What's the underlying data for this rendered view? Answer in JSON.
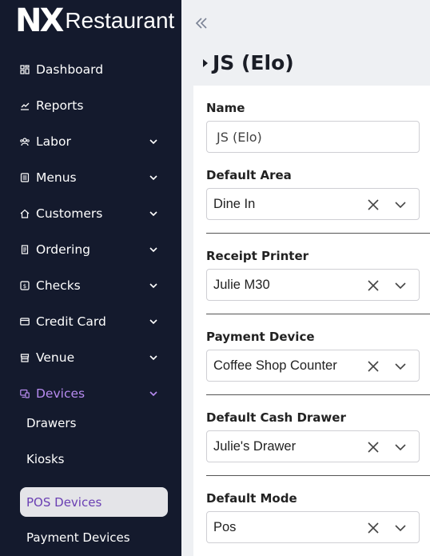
{
  "brand": {
    "mark": "NX",
    "name": "Restaurant"
  },
  "sidebar": {
    "items": [
      {
        "label": "Dashboard",
        "icon": "dashboard-icon",
        "expandable": false
      },
      {
        "label": "Reports",
        "icon": "chart-icon",
        "expandable": false
      },
      {
        "label": "Labor",
        "icon": "users-icon",
        "expandable": true
      },
      {
        "label": "Menus",
        "icon": "menu-icon",
        "expandable": true
      },
      {
        "label": "Customers",
        "icon": "home-icon",
        "expandable": true
      },
      {
        "label": "Ordering",
        "icon": "receipt-icon",
        "expandable": true
      },
      {
        "label": "Checks",
        "icon": "dollar-icon",
        "expandable": true
      },
      {
        "label": "Credit Card",
        "icon": "credit-card-icon",
        "expandable": true
      },
      {
        "label": "Venue",
        "icon": "store-icon",
        "expandable": true
      },
      {
        "label": "Devices",
        "icon": "devices-icon",
        "expandable": true,
        "active": true
      }
    ],
    "sub_items": [
      "Drawers",
      "Kiosks",
      "POS Devices",
      "Payment Devices"
    ],
    "active_sub": "POS Devices",
    "accent": "#b78bf0"
  },
  "main": {
    "title": "JS (Elo)",
    "fields": {
      "name": {
        "label": "Name",
        "value": "JS (Elo)"
      },
      "default_area": {
        "label": "Default Area",
        "value": "Dine In"
      },
      "receipt_printer": {
        "label": "Receipt Printer",
        "value": "Julie M30"
      },
      "payment_device": {
        "label": "Payment Device",
        "value": "Coffee Shop Counter"
      },
      "default_cash_drawer": {
        "label": "Default Cash Drawer",
        "value": "Julie's Drawer"
      },
      "default_mode": {
        "label": "Default Mode",
        "value": "Pos"
      }
    }
  }
}
